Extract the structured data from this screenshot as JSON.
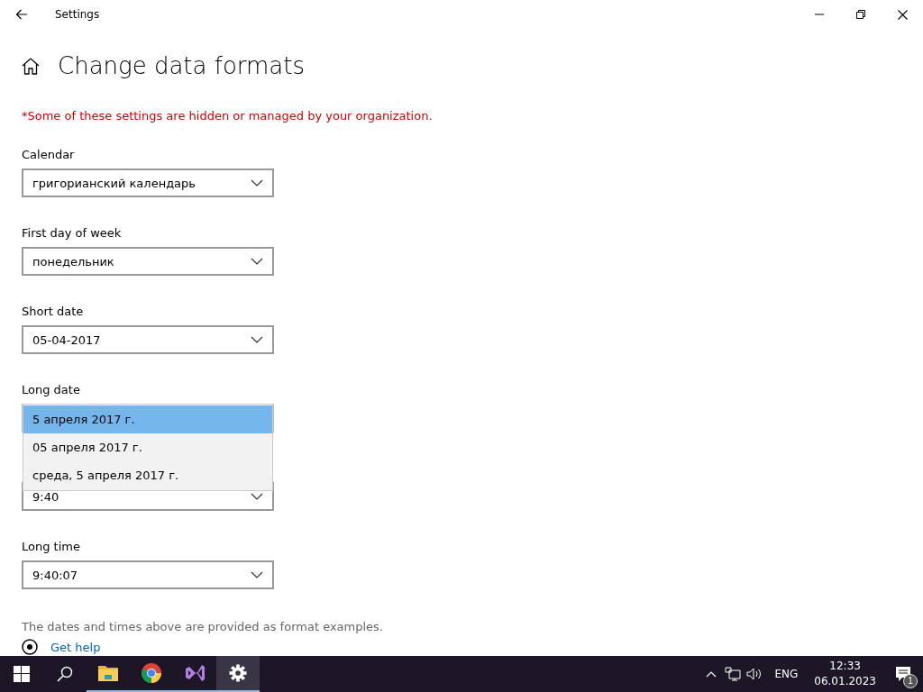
{
  "window": {
    "title": "Settings"
  },
  "page": {
    "title": "Change data formats",
    "notice": "*Some of these settings are hidden or managed by your organization."
  },
  "fields": [
    {
      "label": "Calendar",
      "value": "григорианский календарь",
      "expanded": false
    },
    {
      "label": "First day of week",
      "value": "понедельник",
      "expanded": false
    },
    {
      "label": "Short date",
      "value": "05-04-2017",
      "expanded": false
    },
    {
      "label": "Long date",
      "expanded": true,
      "options": [
        {
          "text": "5 апреля 2017 г.",
          "selected": true
        },
        {
          "text": "05 апреля 2017 г.",
          "selected": false
        },
        {
          "text": "среда, 5 апреля 2017 г.",
          "selected": false
        }
      ]
    },
    {
      "value": "9:40",
      "expanded": false
    },
    {
      "label": "Long time",
      "value": "9:40:07",
      "expanded": false
    }
  ],
  "footnote": "The dates and times above are provided as format examples.",
  "help_link": "Get help",
  "taskbar": {
    "apps": [
      {
        "kind": "explorer",
        "selected": false
      },
      {
        "kind": "chrome",
        "selected": false
      },
      {
        "kind": "studio",
        "selected": false
      },
      {
        "kind": "settings",
        "selected": true
      }
    ],
    "language": "ENG",
    "time": "12:33",
    "date": "06.01.2023",
    "notifications": "1"
  }
}
